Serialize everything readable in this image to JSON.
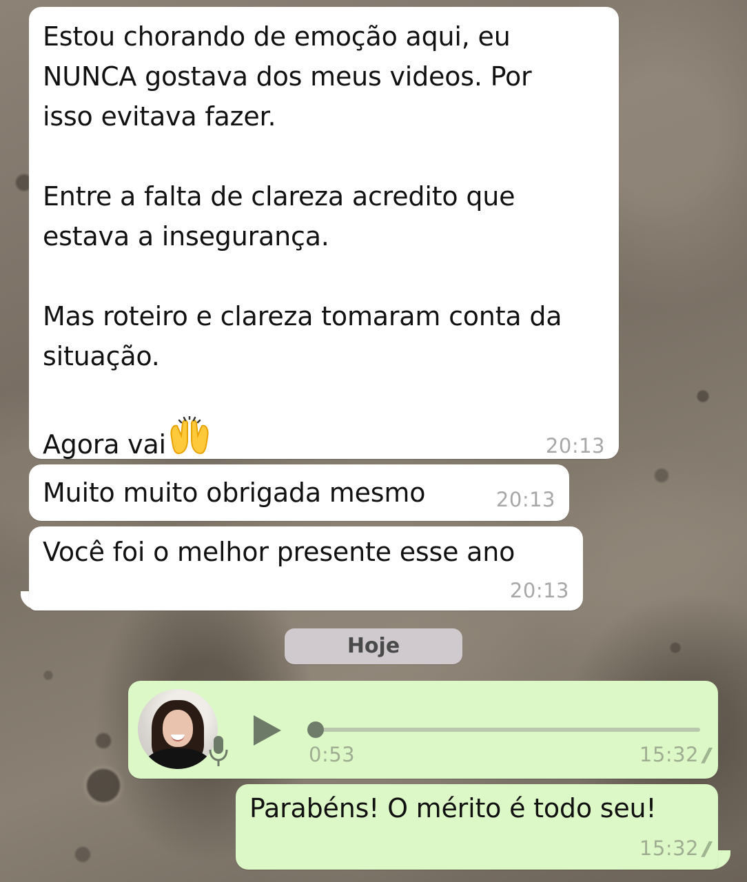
{
  "messages": [
    {
      "direction": "incoming",
      "text": "Estou chorando de emoção aqui, eu\nNUNCA gostava dos meus videos. Por\nisso evitava fazer.\n\nEntre a falta de clareza acredito que\nestava a insegurança.\n\nMas roteiro e clareza tomaram conta da\nsituação.\n\nAgora vai",
      "emoji": "raising-hands",
      "time": "20:13"
    },
    {
      "direction": "incoming",
      "text": "Muito muito obrigada mesmo",
      "time": "20:13"
    },
    {
      "direction": "incoming",
      "text": "Você foi o melhor presente esse ano",
      "time": "20:13"
    }
  ],
  "date_separator": "Hoje",
  "voice_message": {
    "direction": "outgoing",
    "duration": "0:53",
    "time": "15:32",
    "status": "read-double-check",
    "progress": 0,
    "icons": [
      "avatar",
      "mic-icon",
      "play-icon"
    ]
  },
  "outgoing_message": {
    "text": "Parabéns! O mérito é todo seu!",
    "time": "15:32",
    "status": "read-double-check"
  },
  "colors": {
    "incoming_bubble": "#ffffff",
    "outgoing_bubble": "#dcf8c6",
    "timestamp": "#a7a7a7",
    "date_pill": "#d6d0d6"
  }
}
